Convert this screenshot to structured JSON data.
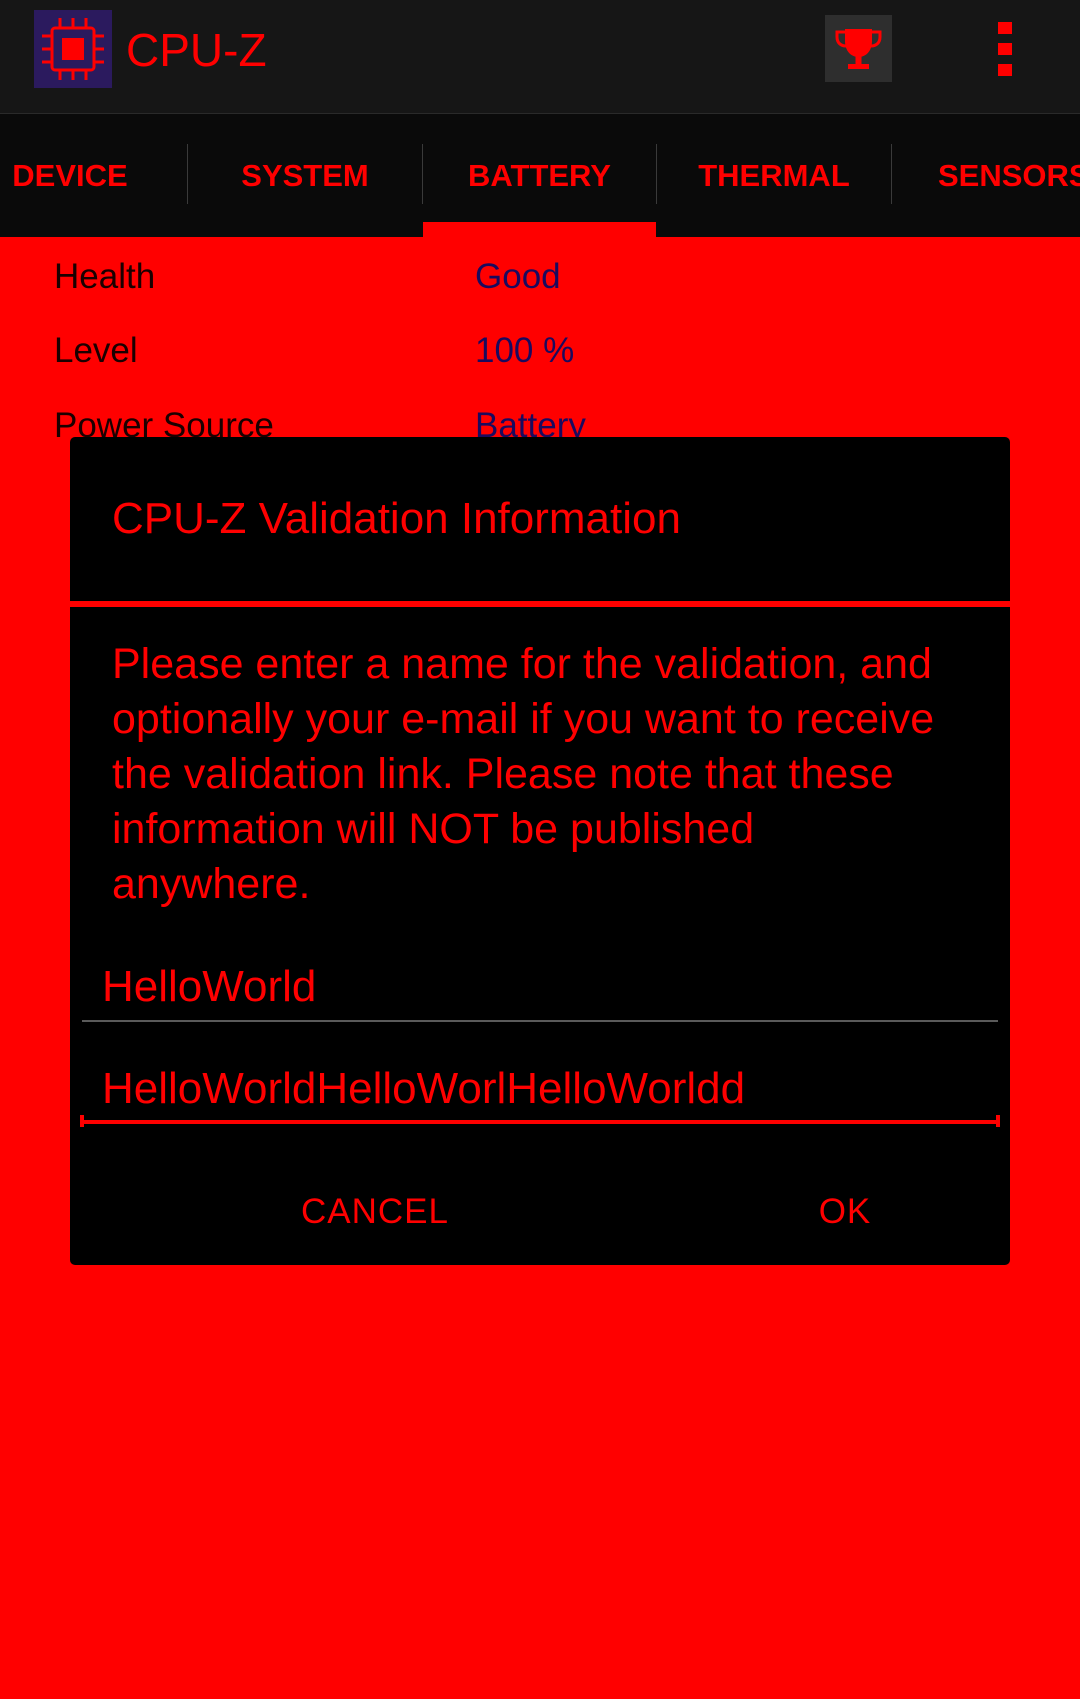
{
  "app": {
    "title": "CPU-Z",
    "icons": {
      "logo": "cpu-chip-icon",
      "trophy": "trophy-icon",
      "overflow": "more-vert-icon"
    }
  },
  "colors": {
    "background": "#ff0000",
    "appbar": "#161616",
    "tabbar": "#0a0a0a",
    "dialog": "#000000",
    "accent": "#ff0000",
    "label_text": "#1a0000",
    "value_text": "#1a0a5e"
  },
  "tabs": [
    {
      "label": "DEVICE",
      "active": false
    },
    {
      "label": "SYSTEM",
      "active": false
    },
    {
      "label": "BATTERY",
      "active": true
    },
    {
      "label": "THERMAL",
      "active": false
    },
    {
      "label": "SENSORS",
      "active": false
    }
  ],
  "battery": {
    "rows": [
      {
        "label": "Health",
        "value": "Good"
      },
      {
        "label": "Level",
        "value": "100 %"
      },
      {
        "label": "Power Source",
        "value": "Battery"
      }
    ]
  },
  "dialog": {
    "title": "CPU-Z Validation Information",
    "message": "Please enter a name for the validation, and optionally your e-mail if you want to receive the validation link. Please note that these information will NOT be published anywhere.",
    "name_value": "HelloWorld",
    "email_value": "HelloWorldHelloWorlHelloWorldd",
    "cancel_label": "CANCEL",
    "ok_label": "OK"
  }
}
